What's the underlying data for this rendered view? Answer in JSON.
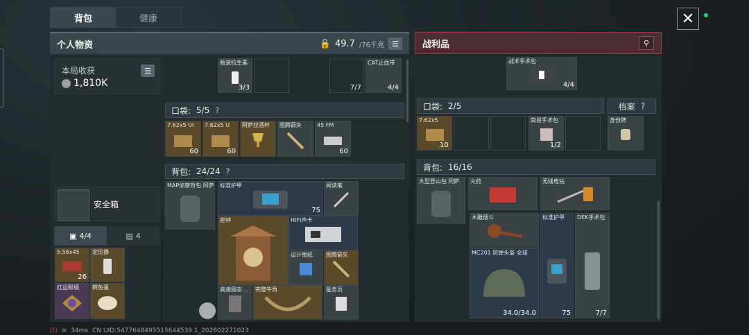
{
  "tabs": {
    "backpack": "背包",
    "health": "健康"
  },
  "personal": {
    "title": "个人物资",
    "weight": "49.7",
    "weight_max": "/76千克",
    "income_label": "本局收获",
    "income_value": "1,810K",
    "safebox_label": "安全箱",
    "safe_tab1": "4/4",
    "safe_tab2": "4",
    "pocket_label": "口袋:",
    "pocket_count": "5/5",
    "help": "?",
    "backpack_label": "背包:",
    "backpack_count": "24/24",
    "top_items": [
      {
        "name": "瓶装抗生素",
        "count": "3/3"
      },
      {
        "name": "",
        "count": "7/7"
      },
      {
        "name": "CAT止血带",
        "count": "4/4"
      }
    ],
    "safe_items": [
      {
        "name": "5.56x45",
        "count": "26"
      },
      {
        "name": "定位器",
        "count": ""
      },
      {
        "name": "红运眼镜",
        "count": ""
      },
      {
        "name": "鳄鱼蛋",
        "count": ""
      }
    ],
    "pocket_items": [
      {
        "name": "7.62x5 UI",
        "count": "60"
      },
      {
        "name": "7.62x5 U",
        "count": "60"
      },
      {
        "name": "阿萨拉酒杯",
        "count": ""
      },
      {
        "name": "图腾箭矢",
        "count": ""
      },
      {
        "name": "45 FM",
        "count": "60"
      }
    ],
    "bag_items": [
      {
        "name": "MAP侦察背包 阿萨",
        "count": ""
      },
      {
        "name": "标准护甲",
        "count": "75"
      },
      {
        "name": "阅读笔",
        "count": ""
      },
      {
        "name": "座钟",
        "count": ""
      },
      {
        "name": "HIFI声卡",
        "count": ""
      },
      {
        "name": "设计图纸",
        "count": ""
      },
      {
        "name": "图腾箭矢",
        "count": ""
      },
      {
        "name": "高速固态…",
        "count": ""
      },
      {
        "name": "完整牛角",
        "count": ""
      },
      {
        "name": "医务员",
        "count": ""
      }
    ]
  },
  "loot": {
    "title": "战利品",
    "pocket_label": "口袋:",
    "pocket_count": "2/5",
    "archive_label": "档案",
    "help": "?",
    "backpack_label": "背包:",
    "backpack_count": "16/16",
    "top_items": [
      {
        "name": "战术手术包",
        "count": "4/4"
      }
    ],
    "pocket_items": [
      {
        "name": "7.62x5",
        "count": "10"
      },
      {
        "name": "简易手术包",
        "count": "1/2"
      },
      {
        "name": "身份牌",
        "count": ""
      }
    ],
    "bag_items": [
      {
        "name": "大型登山包 阿萨",
        "count": ""
      },
      {
        "name": "火药",
        "count": ""
      },
      {
        "name": "无线电钻",
        "count": ""
      },
      {
        "name": "木雕烟斗",
        "count": ""
      },
      {
        "name": "标准护甲",
        "count": "75"
      },
      {
        "name": "DEK手术包",
        "count": "7/7"
      },
      {
        "name": "MC201 防弹头盔 全球",
        "count": "34.0/34.0"
      }
    ]
  },
  "status": {
    "signal": "(!)",
    "ping": "34ms",
    "uid": "CN UID:5477648495515644539 1_202602271023"
  },
  "icons": {
    "close": "close-icon",
    "list": "list-icon",
    "location": "location-pin-icon",
    "weight": "weight-icon",
    "coin": "coin-icon"
  }
}
